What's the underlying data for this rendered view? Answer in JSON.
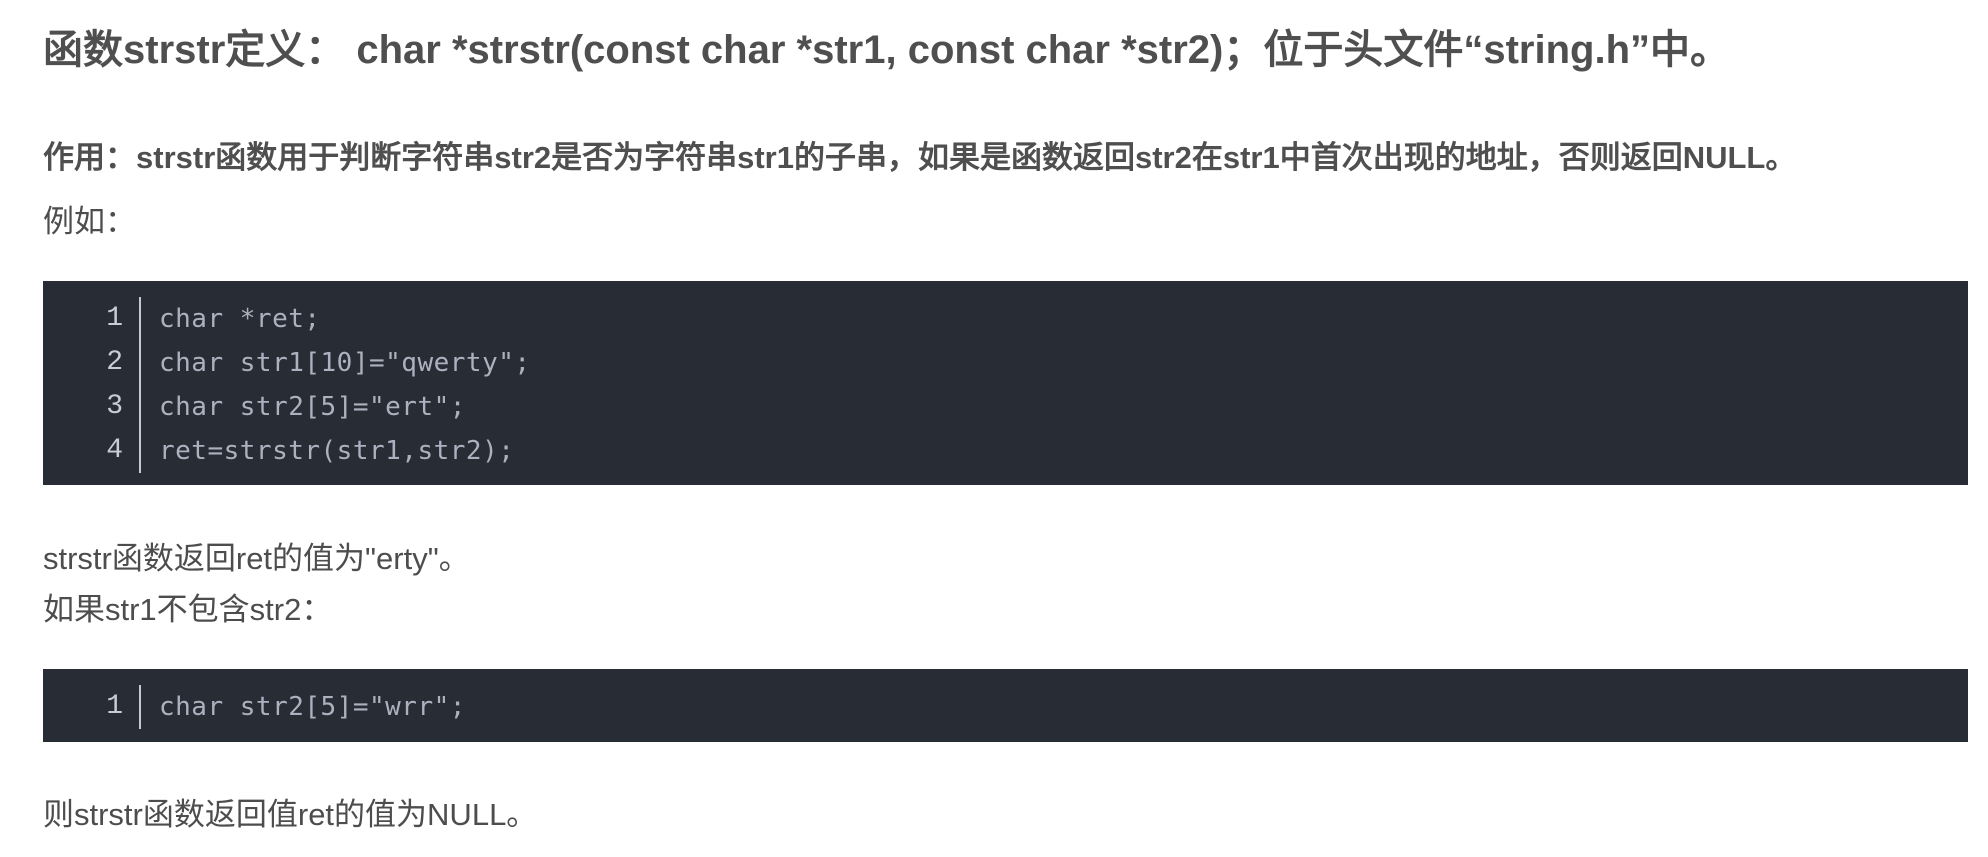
{
  "heading": "函数strstr定义： char *strstr(const char *str1, const char *str2)；位于头文件“string.h”中。",
  "purpose": "作用：strstr函数用于判断字符串str2是否为字符串str1的子串，如果是函数返回str2在str1中首次出现的地址，否则返回NULL。",
  "example_label": "例如：",
  "code_block_1": {
    "lines": [
      {
        "no": "1",
        "code": "char *ret;"
      },
      {
        "no": "2",
        "code": "char str1[10]=\"qwerty\";"
      },
      {
        "no": "3",
        "code": "char str2[5]=\"ert\";"
      },
      {
        "no": "4",
        "code": "ret=strstr(str1,str2);"
      }
    ]
  },
  "result_1": "strstr函数返回ret的值为\"erty\"。",
  "if_not_contains": "如果str1不包含str2：",
  "code_block_2": {
    "lines": [
      {
        "no": "1",
        "code": "char str2[5]=\"wrr\";"
      }
    ]
  },
  "result_2": "则strstr函数返回值ret的值为NULL。",
  "colors": {
    "code_background": "#282c34",
    "code_text": "#abb2bf",
    "body_text": "#4d4d4d"
  }
}
